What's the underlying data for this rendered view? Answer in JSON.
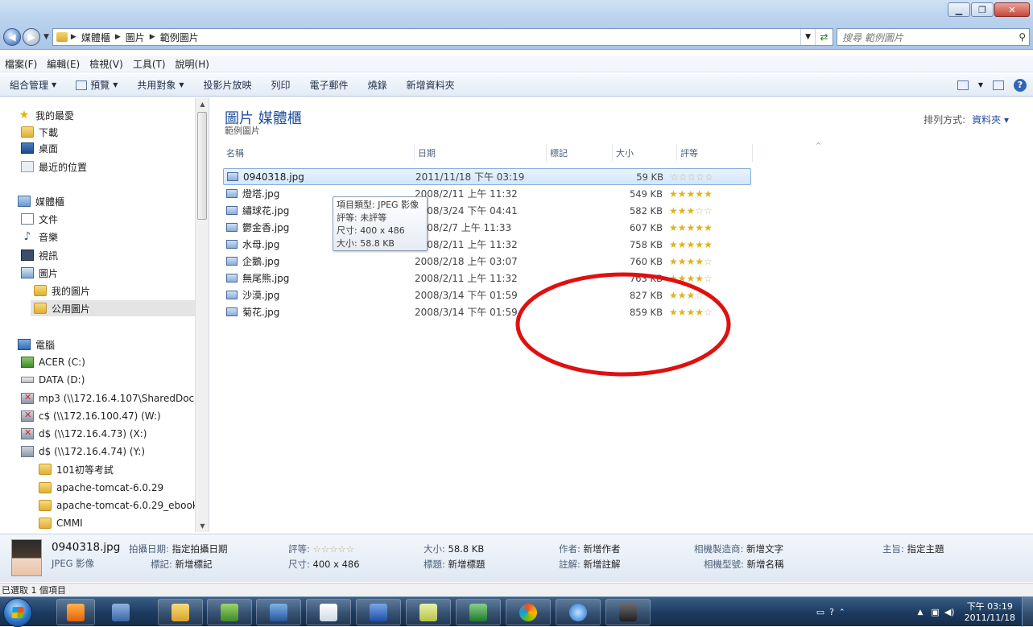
{
  "address": {
    "crumbs": [
      "媒體櫃",
      "圖片",
      "範例圖片"
    ],
    "search_placeholder": "搜尋 範例圖片"
  },
  "menubar": [
    "檔案(F)",
    "編輯(E)",
    "檢視(V)",
    "工具(T)",
    "說明(H)"
  ],
  "commands": [
    "組合管理",
    "預覽",
    "共用對象",
    "投影片放映",
    "列印",
    "電子郵件",
    "燒錄",
    "新增資料夾"
  ],
  "nav": {
    "favorites": "我的最愛",
    "downloads": "下載",
    "desktop": "桌面",
    "recent": "最近的位置",
    "libraries": "媒體櫃",
    "documents": "文件",
    "music": "音樂",
    "videos": "視訊",
    "pictures": "圖片",
    "my_pictures": "我的圖片",
    "public_pictures": "公用圖片",
    "computer": "電腦",
    "drive_c": "ACER (C:)",
    "drive_d": "DATA (D:)",
    "net_mp3": "mp3 (\\\\172.16.4.107\\SharedDoc",
    "net_w": "c$ (\\\\172.16.100.47) (W:)",
    "net_x": "d$ (\\\\172.16.4.73) (X:)",
    "net_y": "d$ (\\\\172.16.4.74) (Y:)",
    "folder_1": "101初等考試",
    "folder_2": "apache-tomcat-6.0.29",
    "folder_3": "apache-tomcat-6.0.29_ebook",
    "folder_4": "CMMI"
  },
  "content": {
    "library_title": "圖片 媒體櫃",
    "library_subtitle": "範例圖片",
    "arrange_label": "排列方式:",
    "arrange_value": "資料夾 ▾",
    "columns": {
      "name": "名稱",
      "date": "日期",
      "tags": "標記",
      "size": "大小",
      "rating": "評等"
    },
    "files": [
      {
        "name": "0940318.jpg",
        "date": "2011/11/18 下午 03:19",
        "size": "59 KB",
        "rating": 0
      },
      {
        "name": "燈塔.jpg",
        "date": "2008/2/11 上午 11:32",
        "size": "549 KB",
        "rating": 5
      },
      {
        "name": "繡球花.jpg",
        "date": "2008/3/24 下午 04:41",
        "size": "582 KB",
        "rating": 3
      },
      {
        "name": "鬱金香.jpg",
        "date": "2008/2/7 上午 11:33",
        "size": "607 KB",
        "rating": 5
      },
      {
        "name": "水母.jpg",
        "date": "2008/2/11 上午 11:32",
        "size": "758 KB",
        "rating": 5
      },
      {
        "name": "企鵝.jpg",
        "date": "2008/2/18 上午 03:07",
        "size": "760 KB",
        "rating": 4
      },
      {
        "name": "無尾熊.jpg",
        "date": "2008/2/11 上午 11:32",
        "size": "763 KB",
        "rating": 4
      },
      {
        "name": "沙漠.jpg",
        "date": "2008/3/14 下午 01:59",
        "size": "827 KB",
        "rating": 3
      },
      {
        "name": "菊花.jpg",
        "date": "2008/3/14 下午 01:59",
        "size": "859 KB",
        "rating": 4
      }
    ]
  },
  "tooltip": {
    "type": "項目類型: JPEG 影像",
    "rating": "評等: 未評等",
    "dimensions": "尺寸: 400 x 486",
    "size": "大小: 58.8 KB"
  },
  "details": {
    "filename": "0940318.jpg",
    "filetype": "JPEG 影像",
    "date_label": "拍攝日期:",
    "date_value": "指定拍攝日期",
    "tags_label": "標記:",
    "tags_value": "新增標記",
    "rating_label": "評等:",
    "dims_label": "尺寸:",
    "dims_value": "400 x 486",
    "size_label": "大小:",
    "size_value": "58.8 KB",
    "title_label": "標題:",
    "title_value": "新增標題",
    "author_label": "作者:",
    "author_value": "新增作者",
    "comment_label": "註解:",
    "comment_value": "新增註解",
    "maker_label": "相機製造商:",
    "maker_value": "新增文字",
    "model_label": "相機型號:",
    "model_value": "新增名稱",
    "subject_label": "主旨:",
    "subject_value": "指定主題"
  },
  "status": "已選取 1 個項目",
  "clock": {
    "time": "下午 03:19",
    "date": "2011/11/18"
  }
}
